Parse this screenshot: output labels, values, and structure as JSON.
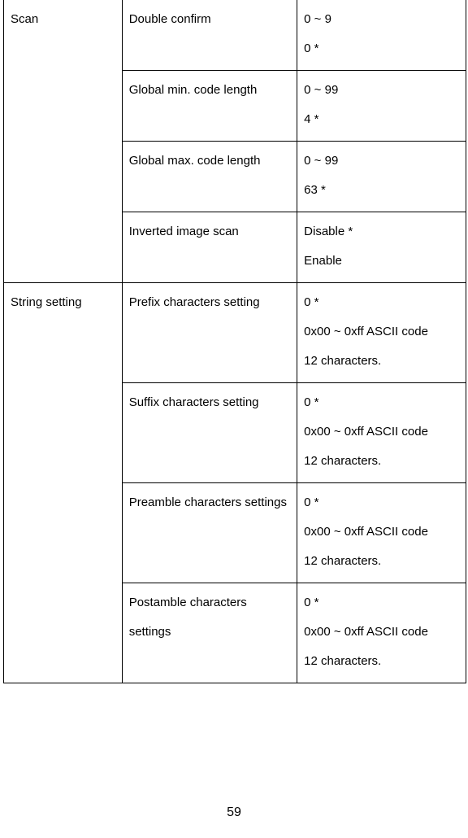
{
  "table": {
    "rows": [
      {
        "category": "Scan",
        "param": "Double confirm",
        "options": [
          "0 ~ 9",
          "0 *"
        ]
      },
      {
        "param": "Global min. code length",
        "options": [
          "0 ~ 99",
          "4 *"
        ]
      },
      {
        "param": "Global max. code length",
        "options": [
          "0 ~ 99",
          "63 *"
        ]
      },
      {
        "param": "Inverted image scan",
        "options": [
          "Disable *",
          "Enable"
        ]
      },
      {
        "category": "String setting",
        "param": "Prefix characters setting",
        "options": [
          "0 *",
          "0x00 ~ 0xff ASCII code",
          "12 characters."
        ]
      },
      {
        "param": "Suffix characters setting",
        "options": [
          "0 *",
          "0x00 ~ 0xff ASCII code",
          "12 characters."
        ]
      },
      {
        "param": "Preamble characters settings",
        "options": [
          "0 *",
          "0x00 ~ 0xff ASCII code",
          "12 characters."
        ]
      },
      {
        "param": "Postamble characters settings",
        "options": [
          "0 *",
          "0x00 ~ 0xff ASCII code",
          "12 characters."
        ]
      }
    ]
  },
  "page_number": "59"
}
